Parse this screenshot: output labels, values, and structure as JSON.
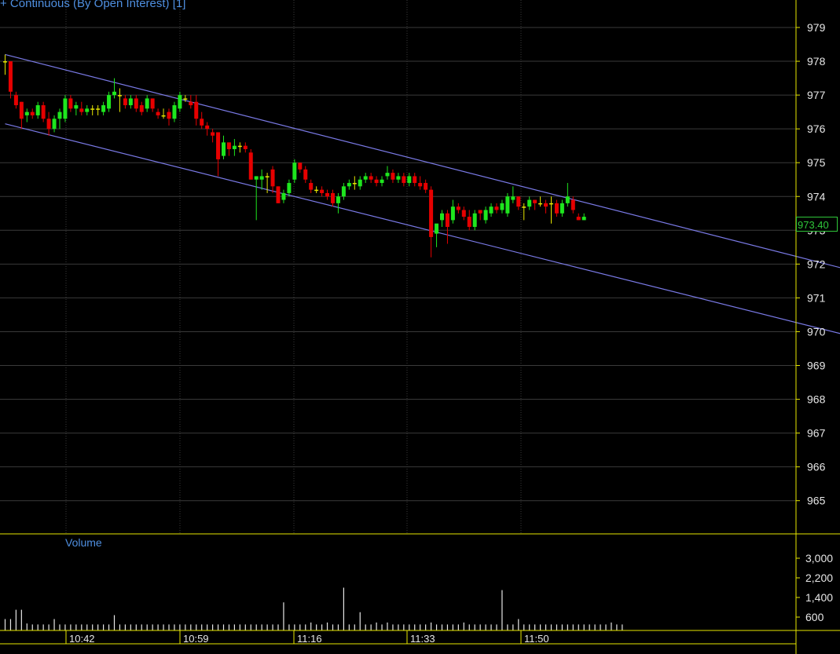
{
  "chart_title": "+ Continuous (By Open Interest) [1]",
  "volume_title": "Volume",
  "last_price_label": "973.40",
  "colors": {
    "background": "#000000",
    "up": "#1ee61e",
    "down": "#e60000",
    "doji": "#e6e600",
    "axis": "#e6e600",
    "grid": "#3a3a3a",
    "channel": "#7a7ae6",
    "volume": "#e6e6e6",
    "text": "#e6e6e6",
    "title": "#4f8fe0",
    "last_price": "#2fc73a"
  },
  "chart_data": [
    {
      "type": "candlestick",
      "title": "+ Continuous (By Open Interest) [1]",
      "x_tick_labels": [
        "10:42",
        "10:59",
        "11:16",
        "11:33",
        "11:50"
      ],
      "y_tick_labels": [
        "979",
        "978",
        "977",
        "976",
        "975",
        "974",
        "973",
        "972",
        "971",
        "970",
        "969",
        "968",
        "967",
        "966",
        "965"
      ],
      "ylim": [
        964.0,
        979.8
      ],
      "grid": true,
      "last_price": 973.4,
      "ohlc": [
        [
          978.0,
          978.2,
          977.6,
          978.0
        ],
        [
          978.0,
          978.0,
          976.9,
          977.1
        ],
        [
          977.0,
          977.1,
          976.6,
          976.7
        ],
        [
          976.8,
          976.8,
          976.0,
          976.3
        ],
        [
          976.4,
          976.6,
          976.2,
          976.5
        ],
        [
          976.5,
          976.6,
          976.3,
          976.4
        ],
        [
          976.4,
          976.8,
          976.3,
          976.7
        ],
        [
          976.7,
          976.8,
          976.2,
          976.3
        ],
        [
          976.3,
          976.5,
          975.8,
          976.0
        ],
        [
          976.0,
          976.4,
          975.9,
          976.3
        ],
        [
          976.3,
          976.6,
          976.0,
          976.5
        ],
        [
          976.3,
          977.0,
          976.2,
          976.9
        ],
        [
          976.9,
          977.0,
          976.5,
          976.6
        ],
        [
          976.6,
          976.8,
          976.4,
          976.7
        ],
        [
          976.6,
          976.8,
          976.4,
          976.5
        ],
        [
          976.5,
          976.7,
          976.4,
          976.6
        ],
        [
          976.6,
          976.7,
          976.4,
          976.6
        ],
        [
          976.6,
          976.7,
          976.4,
          976.6
        ],
        [
          976.5,
          976.8,
          976.4,
          976.7
        ],
        [
          976.6,
          977.1,
          976.5,
          977.0
        ],
        [
          977.0,
          977.5,
          976.9,
          977.1
        ],
        [
          977.0,
          977.2,
          976.5,
          977.0
        ],
        [
          976.9,
          977.0,
          976.6,
          976.7
        ],
        [
          976.7,
          977.0,
          976.6,
          976.9
        ],
        [
          976.9,
          977.0,
          976.5,
          976.6
        ],
        [
          976.7,
          976.8,
          976.4,
          976.5
        ],
        [
          976.6,
          977.0,
          976.5,
          976.9
        ],
        [
          976.9,
          976.9,
          976.5,
          976.6
        ],
        [
          976.5,
          976.6,
          976.3,
          976.4
        ],
        [
          976.4,
          976.6,
          976.3,
          976.4
        ],
        [
          976.5,
          976.6,
          976.1,
          976.3
        ],
        [
          976.3,
          976.8,
          976.2,
          976.7
        ],
        [
          976.6,
          977.1,
          976.5,
          977.0
        ],
        [
          976.9,
          977.0,
          976.8,
          976.9
        ],
        [
          976.8,
          977.0,
          976.6,
          976.7
        ],
        [
          976.8,
          977.0,
          976.1,
          976.3
        ],
        [
          976.3,
          976.5,
          976.0,
          976.1
        ],
        [
          976.1,
          976.2,
          975.8,
          976.0
        ],
        [
          975.9,
          976.0,
          975.6,
          975.8
        ],
        [
          975.9,
          975.9,
          974.6,
          975.1
        ],
        [
          975.2,
          975.8,
          975.1,
          975.6
        ],
        [
          975.6,
          975.6,
          975.2,
          975.4
        ],
        [
          975.4,
          975.7,
          975.2,
          975.5
        ],
        [
          975.5,
          975.6,
          975.3,
          975.5
        ],
        [
          975.5,
          975.6,
          975.3,
          975.4
        ],
        [
          975.3,
          975.4,
          974.5,
          974.5
        ],
        [
          974.5,
          974.6,
          973.3,
          974.6
        ],
        [
          974.5,
          974.8,
          974.2,
          974.6
        ],
        [
          974.6,
          974.7,
          974.1,
          974.6
        ],
        [
          974.8,
          974.9,
          974.1,
          974.3
        ],
        [
          974.3,
          974.3,
          973.8,
          973.8
        ],
        [
          973.9,
          974.2,
          973.8,
          974.1
        ],
        [
          974.1,
          974.5,
          974.0,
          974.4
        ],
        [
          974.5,
          975.1,
          974.4,
          975.0
        ],
        [
          975.0,
          975.0,
          974.7,
          974.8
        ],
        [
          974.8,
          974.9,
          974.4,
          974.5
        ],
        [
          974.4,
          974.5,
          974.1,
          974.2
        ],
        [
          974.2,
          974.3,
          974.1,
          974.2
        ],
        [
          974.2,
          974.3,
          974.0,
          974.1
        ],
        [
          974.1,
          974.2,
          973.9,
          974.0
        ],
        [
          974.1,
          974.2,
          973.7,
          973.8
        ],
        [
          973.8,
          974.1,
          973.5,
          974.0
        ],
        [
          974.0,
          974.4,
          973.9,
          974.3
        ],
        [
          974.3,
          974.5,
          974.2,
          974.4
        ],
        [
          974.4,
          974.6,
          974.2,
          974.4
        ],
        [
          974.3,
          974.6,
          974.2,
          974.5
        ],
        [
          974.5,
          974.7,
          974.4,
          974.6
        ],
        [
          974.6,
          974.7,
          974.4,
          974.5
        ],
        [
          974.5,
          974.6,
          974.3,
          974.4
        ],
        [
          974.4,
          974.6,
          974.3,
          974.5
        ],
        [
          974.6,
          974.9,
          974.5,
          974.7
        ],
        [
          974.7,
          974.8,
          974.4,
          974.5
        ],
        [
          974.5,
          974.7,
          974.4,
          974.6
        ],
        [
          974.6,
          974.7,
          974.3,
          974.4
        ],
        [
          974.4,
          974.7,
          974.3,
          974.6
        ],
        [
          974.6,
          974.7,
          974.3,
          974.4
        ],
        [
          974.4,
          974.6,
          974.2,
          974.3
        ],
        [
          974.4,
          974.5,
          974.1,
          974.2
        ],
        [
          974.2,
          974.3,
          972.2,
          972.8
        ],
        [
          972.9,
          973.0,
          972.5,
          973.2
        ],
        [
          973.3,
          973.6,
          973.1,
          973.5
        ],
        [
          973.5,
          973.6,
          972.6,
          973.1
        ],
        [
          973.3,
          973.9,
          973.2,
          973.7
        ],
        [
          973.7,
          973.8,
          973.5,
          973.6
        ],
        [
          973.6,
          973.7,
          973.3,
          973.4
        ],
        [
          973.4,
          973.6,
          973.0,
          973.1
        ],
        [
          973.1,
          973.6,
          973.0,
          973.5
        ],
        [
          973.6,
          973.6,
          973.3,
          973.5
        ],
        [
          973.3,
          973.7,
          973.2,
          973.6
        ],
        [
          973.5,
          973.8,
          973.4,
          973.7
        ],
        [
          973.7,
          973.8,
          973.5,
          973.6
        ],
        [
          973.6,
          973.9,
          973.5,
          973.8
        ],
        [
          973.5,
          974.1,
          973.4,
          974.0
        ],
        [
          973.9,
          974.3,
          973.8,
          974.0
        ],
        [
          974.0,
          974.0,
          973.6,
          973.7
        ],
        [
          973.7,
          973.8,
          973.3,
          973.7
        ],
        [
          973.7,
          974.0,
          973.6,
          973.9
        ],
        [
          973.9,
          973.9,
          973.6,
          973.8
        ],
        [
          973.8,
          974.0,
          973.7,
          973.8
        ],
        [
          973.8,
          973.9,
          973.5,
          973.7
        ],
        [
          973.8,
          974.0,
          973.2,
          973.8
        ],
        [
          973.8,
          973.9,
          973.4,
          973.5
        ],
        [
          973.5,
          973.9,
          973.4,
          973.8
        ],
        [
          973.8,
          974.4,
          973.7,
          974.0
        ],
        [
          973.9,
          974.0,
          973.5,
          973.6
        ],
        [
          973.4,
          973.5,
          973.3,
          973.3
        ],
        [
          973.3,
          973.5,
          973.3,
          973.4
        ]
      ],
      "channel_lines": [
        {
          "x": [
            0,
            154
          ],
          "y": [
            978.2,
            971.85
          ]
        },
        {
          "x": [
            0,
            154
          ],
          "y": [
            976.15,
            969.9
          ]
        }
      ]
    },
    {
      "type": "bar",
      "title": "Volume",
      "y_tick_labels": [
        "3,000",
        "2,200",
        "1,400",
        "600"
      ],
      "ylim": [
        0,
        3650
      ],
      "values": [
        520,
        520,
        900,
        900,
        340,
        300,
        300,
        300,
        300,
        520,
        300,
        300,
        300,
        300,
        300,
        300,
        300,
        300,
        300,
        300,
        680,
        300,
        300,
        300,
        300,
        300,
        300,
        300,
        300,
        300,
        300,
        300,
        300,
        300,
        300,
        300,
        300,
        300,
        300,
        300,
        300,
        300,
        300,
        300,
        300,
        300,
        300,
        300,
        300,
        300,
        300,
        1200,
        300,
        300,
        300,
        300,
        380,
        300,
        300,
        380,
        300,
        300,
        1800,
        300,
        300,
        800,
        300,
        300,
        380,
        300,
        380,
        300,
        300,
        300,
        300,
        300,
        300,
        300,
        380,
        300,
        300,
        300,
        300,
        300,
        380,
        300,
        300,
        300,
        300,
        300,
        300,
        1700,
        300,
        300,
        520,
        300,
        300,
        300,
        300,
        300,
        300,
        300,
        300,
        300,
        300,
        300,
        300,
        300,
        300,
        300,
        300,
        380,
        300,
        300
      ]
    }
  ]
}
